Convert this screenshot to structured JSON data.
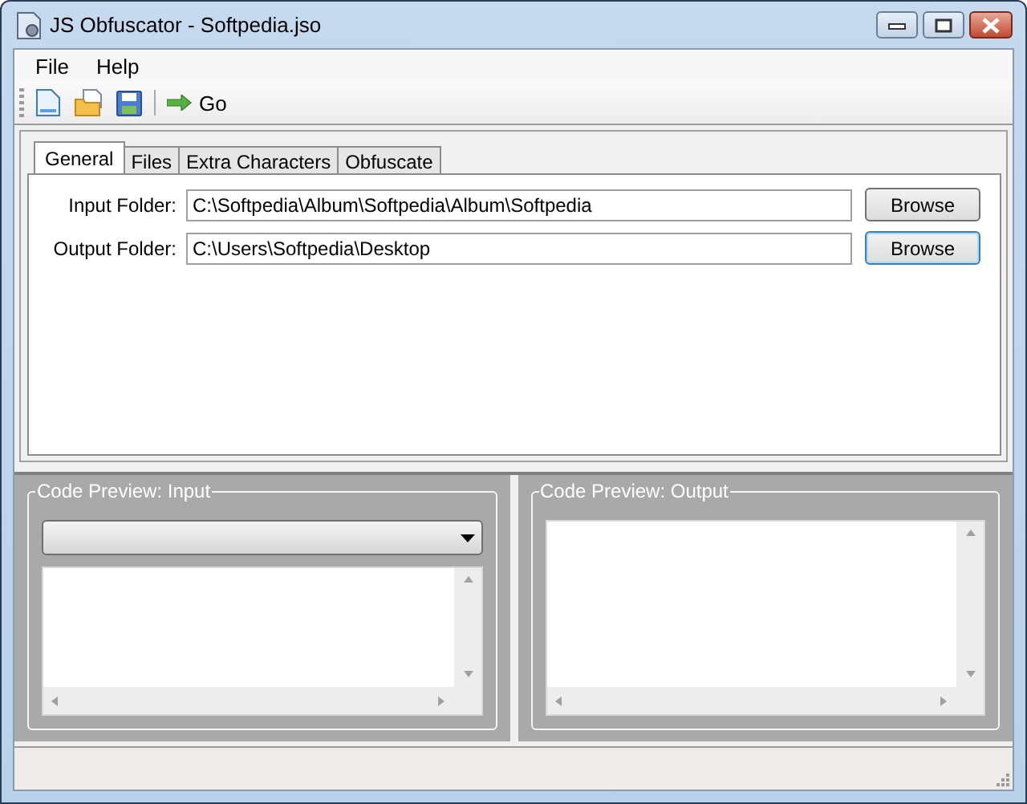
{
  "window": {
    "title": "JS Obfuscator - Softpedia.jso"
  },
  "menu": [
    "File",
    "Help"
  ],
  "toolbar": [
    {
      "kind": "new"
    },
    {
      "kind": "open"
    },
    {
      "kind": "save"
    },
    {
      "kind": "separator"
    },
    {
      "kind": "go",
      "label": "Go"
    }
  ],
  "tabs": [
    {
      "label": "General",
      "selected": true
    },
    {
      "label": "Files",
      "selected": false
    },
    {
      "label": "Extra Characters",
      "selected": false
    },
    {
      "label": "Obfuscate",
      "selected": false
    }
  ],
  "fields": [
    {
      "label": "Input Folder:",
      "value": "C:\\Softpedia\\Album\\Softpedia\\Album\\Softpedia",
      "button": "Browse",
      "focused": false
    },
    {
      "label": "Output Folder:",
      "value": "C:\\Users\\Softpedia\\Desktop",
      "button": "Browse",
      "focused": true
    }
  ],
  "panels": [
    {
      "title": "Code Preview: Input",
      "dropdown": true
    },
    {
      "title": "Code Preview: Output",
      "dropdown": false
    }
  ]
}
